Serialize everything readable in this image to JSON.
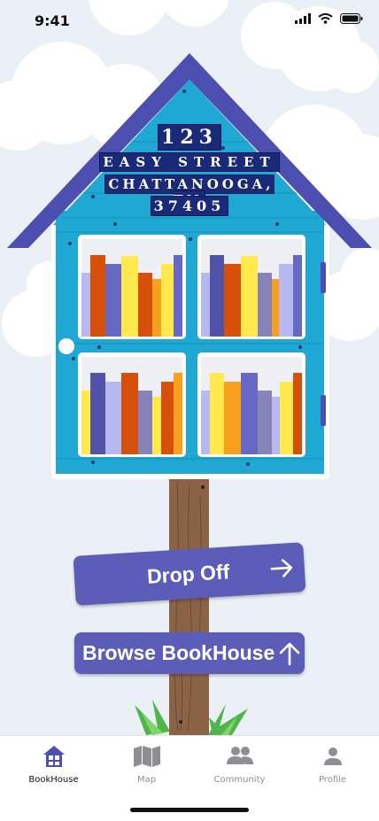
{
  "status_bar": {
    "time": "9:41"
  },
  "house": {
    "address_line1": "123",
    "address_line2": "EASY STREET",
    "address_line3": "CHATTANOOGA, TN",
    "address_line4": "37405",
    "colors": {
      "wall": "#1ea8d3",
      "roof": "#4d4fb0",
      "post": "#8b6347"
    }
  },
  "actions": {
    "drop_off_label": "Drop Off",
    "browse_label": "Browse BookHouse",
    "accent": "#5b5db8"
  },
  "tabs": [
    {
      "label": "BookHouse",
      "icon": "bookhouse-icon",
      "active": true
    },
    {
      "label": "Map",
      "icon": "map-icon",
      "active": false
    },
    {
      "label": "Community",
      "icon": "community-icon",
      "active": false
    },
    {
      "label": "Profile",
      "icon": "profile-icon",
      "active": false
    }
  ]
}
